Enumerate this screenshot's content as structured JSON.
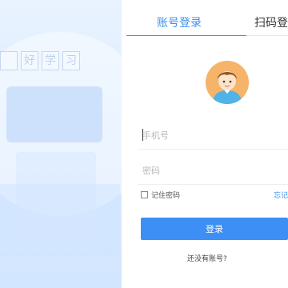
{
  "slogan": [
    "",
    "好",
    "学",
    "习"
  ],
  "tabs": {
    "account_login": "账号登录",
    "qr_login": "扫码登"
  },
  "form": {
    "phone_placeholder": "手机号",
    "password_placeholder": "密码",
    "remember_label": "记住密码",
    "forgot_label": "忘记",
    "login_label": "登录",
    "register_label": "还没有账号?"
  },
  "colors": {
    "accent": "#3d8ff5",
    "avatar_bg": "#f6b46a"
  }
}
